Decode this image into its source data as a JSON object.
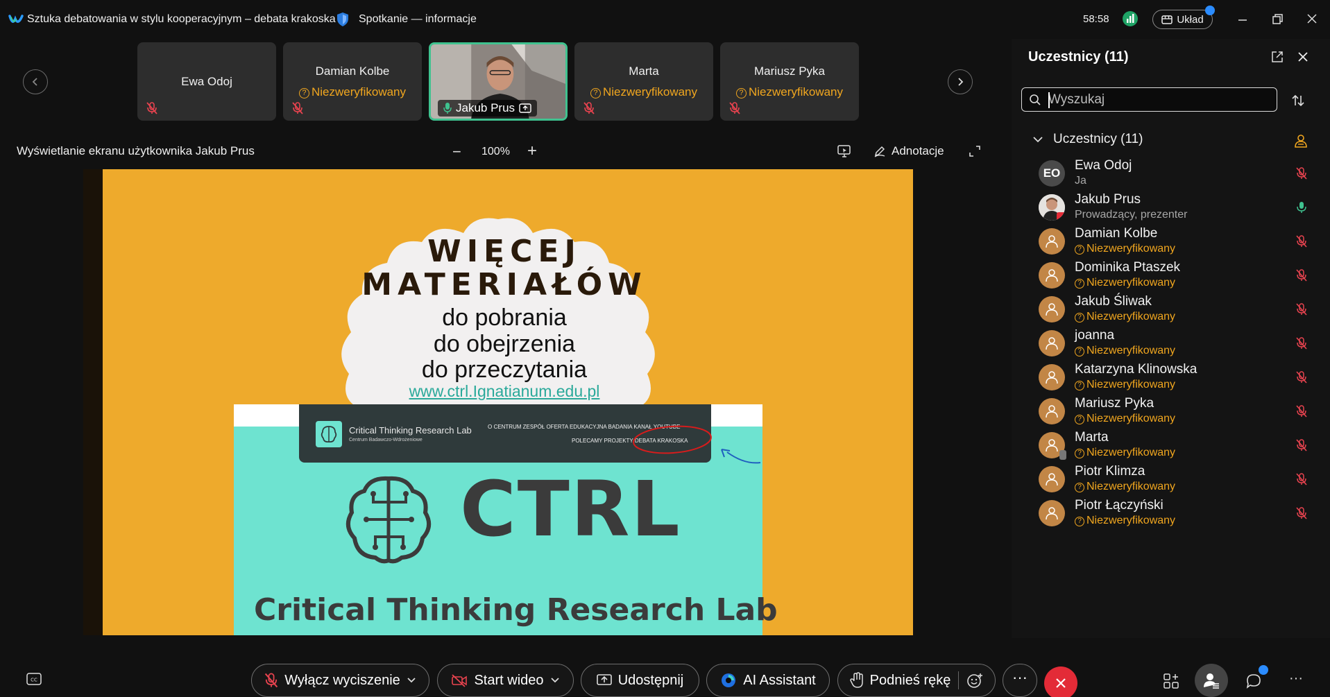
{
  "titlebar": {
    "meeting_title": "Sztuka debatowania w stylu kooperacyjnym – debata krakoska",
    "info_label": "Spotkanie — informacje",
    "timer": "58:58",
    "layout_label": "Układ"
  },
  "thumbnails": [
    {
      "name": "Ewa Odoj",
      "status": ""
    },
    {
      "name": "Damian Kolbe",
      "status": "Niezweryfikowany"
    },
    {
      "name": "Jakub Prus",
      "status": ""
    },
    {
      "name": "Marta",
      "status": "Niezweryfikowany"
    },
    {
      "name": "Mariusz Pyka",
      "status": "Niezweryfikowany"
    }
  ],
  "share": {
    "title": "Wyświetlanie ekranu użytkownika Jakub Prus",
    "zoom": "100%",
    "annotations_label": "Adnotacje"
  },
  "slide": {
    "headline1": "WIĘCEJ",
    "headline2": "MATERIAŁÓW",
    "line1": "do pobrania",
    "line2": "do obejrzenia",
    "line3": "do przeczytania",
    "url": "www.ctrl.Ignatianum.edu.pl",
    "web_name": "Critical Thinking Research Lab",
    "web_sub": "Centrum Badawczo-Wdrożeniowe",
    "nav1": "O CENTRUM   ZESPÓŁ   OFERTA EDUKACYJNA   BADANIA   KANAŁ YOUTUBE",
    "nav2": "POLECAMY   PROJEKTY   DEBATA KRAKOSKA",
    "logo_text": "CTRL",
    "logo_sub": "Critical Thinking Research Lab"
  },
  "panel": {
    "title": "Uczestnicy (11)",
    "search_placeholder": "Wyszukaj",
    "group_label": "Uczestnicy (11)",
    "participants": [
      {
        "initials": "EO",
        "name": "Ewa Odoj",
        "sub": "Ja",
        "type": "initials",
        "mic": "muted"
      },
      {
        "initials": "",
        "name": "Jakub Prus",
        "sub": "Prowadzący, prezenter",
        "type": "photo",
        "mic": "on"
      },
      {
        "initials": "",
        "name": "Damian Kolbe",
        "sub": "Niezweryfikowany",
        "type": "guest",
        "mic": "muted"
      },
      {
        "initials": "",
        "name": "Dominika Ptaszek",
        "sub": "Niezweryfikowany",
        "type": "guest",
        "mic": "muted"
      },
      {
        "initials": "",
        "name": "Jakub Śliwak",
        "sub": "Niezweryfikowany",
        "type": "guest",
        "mic": "muted"
      },
      {
        "initials": "",
        "name": "joanna",
        "sub": "Niezweryfikowany",
        "type": "guest",
        "mic": "muted"
      },
      {
        "initials": "",
        "name": "Katarzyna Klinowska",
        "sub": "Niezweryfikowany",
        "type": "guest",
        "mic": "muted"
      },
      {
        "initials": "",
        "name": "Mariusz Pyka",
        "sub": "Niezweryfikowany",
        "type": "guest",
        "mic": "muted"
      },
      {
        "initials": "",
        "name": "Marta",
        "sub": "Niezweryfikowany",
        "type": "guest",
        "mic": "muted"
      },
      {
        "initials": "",
        "name": "Piotr Klimza",
        "sub": "Niezweryfikowany",
        "type": "guest",
        "mic": "muted"
      },
      {
        "initials": "",
        "name": "Piotr Łączyński",
        "sub": "Niezweryfikowany",
        "type": "guest",
        "mic": "muted"
      }
    ]
  },
  "controls": {
    "unmute_label": "Wyłącz wyciszenie",
    "video_label": "Start wideo",
    "share_label": "Udostępnij",
    "ai_label": "AI Assistant",
    "hand_label": "Podnieś rękę"
  },
  "colors": {
    "accent_green": "#3fc28f",
    "unverified": "#f0a61f",
    "end_call": "#e32b37",
    "slide_orange": "#eeaa2c",
    "slide_teal": "#6ee3d0"
  }
}
